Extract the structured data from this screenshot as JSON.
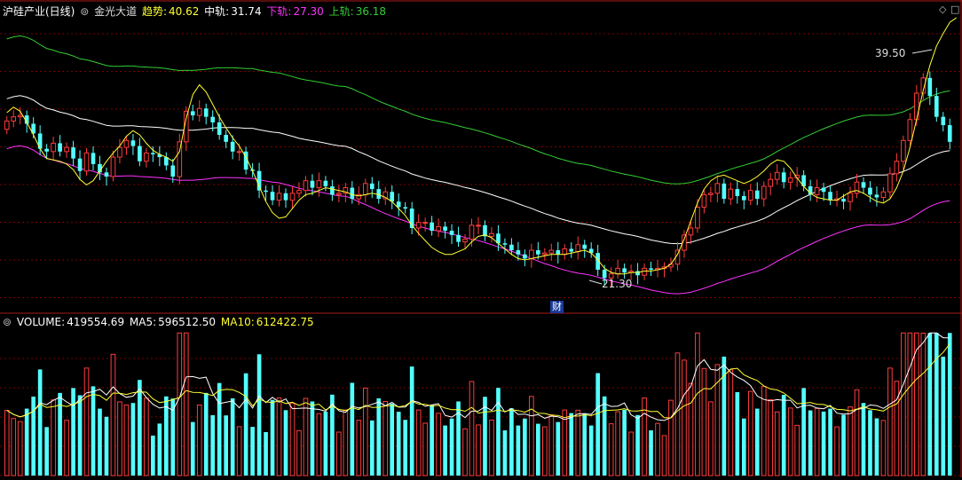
{
  "price_panel": {
    "name": "沪硅产业(日线)",
    "indicator": "金光大道",
    "trend_label": "趋势:",
    "trend_value": "40.62",
    "mid_label": "中轨:",
    "mid_value": "31.74",
    "lower_label": "下轨:",
    "lower_value": "27.30",
    "upper_label": "上轨:",
    "upper_value": "36.18",
    "high_annotation": "39.50",
    "low_annotation": "21.30",
    "finance_marker": "财"
  },
  "volume_panel": {
    "label": "VOLUME:",
    "value": "419554.69",
    "ma5_label": "MA5:",
    "ma5_value": "596512.50",
    "ma10_label": "MA10:",
    "ma10_value": "612422.75"
  },
  "icons": {
    "corner_top": "diamond-icon",
    "volume_toggle": "chevron-down-icon",
    "price_toggle": "chevron-down-icon"
  },
  "colors": {
    "background": "#000000",
    "up": "#ff3c3c",
    "down": "#54ffff",
    "upper_band": "#33cc33",
    "mid_band": "#ffffff",
    "lower_band": "#ff33ff",
    "trend": "#ffff33",
    "grid": "#7a0000"
  },
  "chart_data": {
    "type": "candlestick",
    "price_range": [
      20.2,
      40.5
    ],
    "close": [
      33.2,
      33.5,
      33.6,
      33.0,
      32.3,
      31.2,
      31.0,
      31.6,
      31.0,
      31.3,
      30.5,
      29.6,
      30.9,
      30.1,
      29.5,
      29.2,
      30.6,
      31.3,
      31.8,
      31.4,
      30.3,
      30.9,
      30.8,
      30.6,
      30.0,
      29.2,
      31.7,
      33.9,
      33.6,
      34.1,
      33.5,
      33.1,
      32.2,
      31.7,
      31.0,
      31.0,
      29.7,
      29.6,
      28.2,
      28.1,
      27.5,
      28.0,
      27.5,
      28.0,
      28.2,
      28.9,
      28.4,
      28.9,
      28.5,
      27.9,
      28.0,
      28.4,
      27.6,
      27.9,
      28.7,
      28.3,
      27.6,
      28.1,
      27.4,
      27.0,
      26.9,
      25.5,
      25.9,
      25.9,
      25.3,
      25.6,
      25.3,
      25.0,
      24.5,
      24.7,
      25.7,
      25.7,
      24.9,
      25.1,
      24.4,
      24.3,
      23.9,
      23.6,
      23.3,
      23.9,
      23.6,
      23.7,
      23.9,
      23.6,
      24.0,
      23.8,
      24.3,
      24.0,
      23.7,
      22.5,
      21.9,
      22.2,
      22.6,
      22.3,
      22.4,
      22.1,
      22.6,
      22.5,
      22.6,
      22.7,
      22.9,
      23.9,
      25.0,
      25.5,
      27.0,
      27.9,
      28.0,
      28.7,
      27.6,
      28.3,
      27.8,
      27.5,
      28.2,
      27.6,
      28.5,
      29.0,
      29.5,
      28.8,
      29.1,
      29.3,
      28.5,
      27.9,
      28.4,
      28.1,
      27.5,
      27.6,
      27.4,
      28.0,
      28.8,
      28.4,
      27.9,
      27.7,
      28.1,
      29.4,
      30.3,
      31.8,
      33.3,
      35.2,
      36.3,
      35.0,
      33.5,
      32.9,
      31.7
    ],
    "open": [
      32.6,
      33.2,
      33.5,
      33.6,
      33.0,
      32.3,
      31.2,
      31.0,
      31.6,
      31.0,
      31.3,
      30.5,
      29.6,
      30.9,
      30.1,
      29.5,
      29.2,
      30.6,
      31.3,
      31.8,
      31.4,
      30.3,
      30.9,
      30.8,
      30.6,
      30.0,
      29.2,
      31.7,
      33.9,
      33.6,
      34.1,
      33.5,
      33.1,
      32.2,
      31.7,
      31.0,
      31.0,
      29.7,
      29.6,
      28.2,
      28.1,
      27.5,
      28.0,
      27.5,
      28.0,
      28.2,
      28.9,
      28.4,
      28.9,
      28.5,
      27.9,
      28.0,
      28.4,
      27.6,
      27.9,
      28.7,
      28.3,
      27.6,
      28.1,
      27.4,
      27.0,
      26.9,
      25.5,
      25.9,
      25.9,
      25.3,
      25.6,
      25.3,
      25.0,
      24.5,
      24.7,
      25.7,
      25.7,
      24.9,
      25.1,
      24.4,
      24.3,
      23.9,
      23.6,
      23.3,
      23.9,
      23.6,
      23.7,
      23.9,
      23.6,
      24.0,
      23.8,
      24.3,
      24.0,
      23.7,
      22.5,
      21.9,
      22.2,
      22.6,
      22.3,
      22.4,
      22.1,
      22.6,
      22.5,
      22.6,
      22.7,
      22.9,
      23.9,
      25.0,
      25.5,
      27.0,
      27.9,
      28.0,
      28.7,
      27.6,
      28.3,
      27.8,
      27.5,
      28.2,
      27.6,
      28.5,
      29.0,
      29.5,
      28.8,
      29.1,
      29.3,
      28.5,
      27.9,
      28.4,
      28.1,
      27.5,
      27.6,
      27.4,
      28.0,
      28.8,
      28.4,
      27.9,
      27.7,
      28.1,
      29.4,
      30.3,
      31.8,
      33.3,
      35.2,
      36.3,
      35.0,
      33.5,
      32.9
    ],
    "trend": [
      33.8,
      34.2,
      33.9,
      33.1,
      32.2,
      31.2,
      30.5,
      30.4,
      30.3,
      30.1,
      29.7,
      29.0,
      28.6,
      28.9,
      29.6,
      30.3,
      30.9,
      31.4,
      32.1,
      32.5,
      32.2,
      31.6,
      31.1,
      30.8,
      30.6,
      30.3,
      31.0,
      33.4,
      35.1,
      35.8,
      35.3,
      34.4,
      33.5,
      32.7,
      32.0,
      31.4,
      30.6,
      29.6,
      28.5,
      27.4,
      26.6,
      26.2,
      26.3,
      26.9,
      27.5,
      27.9,
      28.0,
      28.2,
      28.4,
      28.3,
      28.2,
      28.1,
      27.9,
      27.8,
      27.9,
      28.0,
      27.9,
      27.7,
      27.4,
      26.9,
      26.4,
      25.7,
      25.1,
      24.6,
      24.1,
      23.8,
      23.6,
      23.6,
      23.8,
      24.0,
      24.5,
      24.9,
      25.0,
      24.8,
      24.4,
      24.0,
      23.6,
      23.3,
      23.2,
      23.3,
      23.4,
      23.5,
      23.6,
      23.6,
      23.6,
      23.7,
      23.8,
      23.9,
      23.7,
      23.2,
      22.6,
      22.3,
      22.2,
      22.2,
      22.3,
      22.3,
      22.4,
      22.4,
      22.5,
      22.6,
      22.9,
      23.6,
      24.7,
      26.0,
      27.3,
      28.3,
      28.9,
      29.2,
      29.3,
      29.1,
      28.9,
      28.7,
      28.9,
      29.2,
      29.6,
      30.1,
      30.4,
      30.3,
      29.8,
      29.1,
      28.5,
      28.0,
      27.7,
      27.6,
      27.5,
      27.5,
      27.8,
      28.1,
      28.2,
      28.0,
      27.7,
      27.4,
      27.3,
      27.6,
      28.4,
      29.6,
      31.3,
      33.3,
      35.4,
      37.2,
      38.6,
      39.5,
      40.3,
      40.62
    ],
    "volume_max": 750000
  }
}
